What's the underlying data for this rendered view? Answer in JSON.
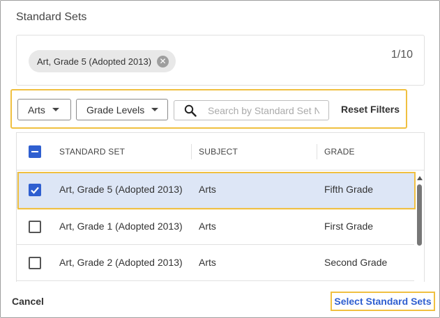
{
  "dialog": {
    "title": "Standard Sets"
  },
  "selected": {
    "chips": [
      {
        "label": "Art, Grade 5 (Adopted 2013)"
      }
    ],
    "count": "1/10"
  },
  "filters": {
    "subject_dropdown": "Arts",
    "grade_dropdown": "Grade Levels",
    "search_placeholder": "Search by Standard Set Name",
    "reset_label": "Reset Filters"
  },
  "table": {
    "columns": [
      "STANDARD SET",
      "SUBJECT",
      "GRADE"
    ],
    "header_checkbox": "indeterminate",
    "rows": [
      {
        "standard_set": "Art, Grade 5 (Adopted 2013)",
        "subject": "Arts",
        "grade": "Fifth Grade",
        "checked": true
      },
      {
        "standard_set": "Art, Grade 1 (Adopted 2013)",
        "subject": "Arts",
        "grade": "First Grade",
        "checked": false
      },
      {
        "standard_set": "Art, Grade 2 (Adopted 2013)",
        "subject": "Arts",
        "grade": "Second Grade",
        "checked": false
      }
    ]
  },
  "footer": {
    "cancel_label": "Cancel",
    "select_label": "Select Standard Sets"
  },
  "colors": {
    "accent_blue": "#2f5fd0",
    "highlight_outline": "#f0c040",
    "selected_row_bg": "#dde6f6"
  },
  "icons": [
    "close-icon",
    "chevron-down-icon",
    "search-icon",
    "checkbox-icon",
    "scroll-up-icon"
  ]
}
